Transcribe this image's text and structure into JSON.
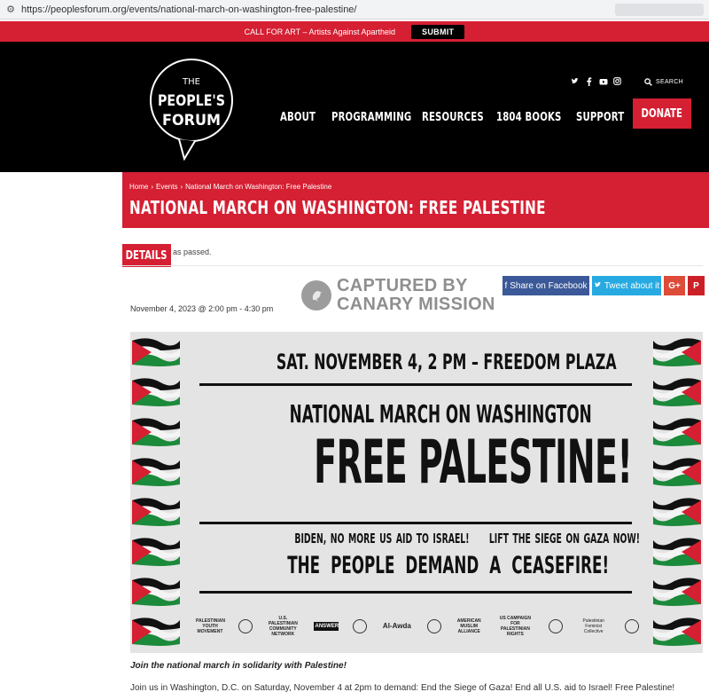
{
  "browser": {
    "url": "https://peoplesforum.org/events/national-march-on-washington-free-palestine/"
  },
  "topbar": {
    "text": "CALL FOR ART – Artists Against Apartheid",
    "submit_label": "SUBMIT"
  },
  "header": {
    "logo_text": [
      "THE",
      "PEOPLE'S",
      "FORUM"
    ],
    "search_label": "SEARCH",
    "nav": [
      {
        "label": "ABOUT"
      },
      {
        "label": "PROGRAMMING"
      },
      {
        "label": "RESOURCES"
      },
      {
        "label": "1804 BOOKS"
      },
      {
        "label": "SUPPORT"
      }
    ],
    "donate_label": "DONATE",
    "social_icons": [
      "twitter-icon",
      "facebook-icon",
      "youtube-icon",
      "instagram-icon"
    ]
  },
  "page": {
    "breadcrumb": [
      "Home",
      "Events",
      "National March on Washington: Free Palestine"
    ],
    "breadcrumb_sep": "›",
    "title": "NATIONAL MARCH ON WASHINGTON: FREE PALESTINE",
    "details_tab": "DETAILS",
    "passed_notice": "as passed.",
    "event_date": "November 4, 2023 @ 2:00 pm - 4:30 pm"
  },
  "watermark": {
    "line1": "CAPTURED BY",
    "line2": "CANARY MISSION"
  },
  "share": {
    "facebook": "Share on Facebook",
    "twitter": "Tweet about it",
    "google": "G+",
    "pinterest": "P"
  },
  "poster": {
    "date_line": "SAT. NOVEMBER 4, 2 PM – FREEDOM PLAZA",
    "march_line": "NATIONAL MARCH ON WASHINGTON",
    "headline": "FREE PALESTINE!",
    "demand1": "BIDEN, NO MORE US AID TO ISRAEL!",
    "demand2": "LIFT THE SIEGE ON GAZA NOW!",
    "ceasefire": "THE PEOPLE DEMAND A CEASEFIRE!",
    "sponsors": [
      "PALESTINIAN YOUTH MOVEMENT",
      "U.S. PALESTINIAN COMMUNITY NETWORK",
      "ANSWER",
      "Al-Awda",
      "AMERICAN MUSLIM ALLIANCE",
      "US CAMPAIGN FOR PALESTINIAN RIGHTS",
      "Palestinian Feminist Collective"
    ]
  },
  "content": {
    "solidarity": "Join the national march in solidarity with Palestine!",
    "body": "Join us in Washington, D.C. on Saturday, November 4 at 2pm to demand: End the Siege of Gaza! End all U.S. aid to Israel! Free Palestine!"
  },
  "colors": {
    "brand_red": "#d51f32",
    "header_black": "#000000",
    "facebook": "#3b5998",
    "twitter": "#27aae1",
    "google": "#dd4b39",
    "pinterest": "#cb2027"
  }
}
